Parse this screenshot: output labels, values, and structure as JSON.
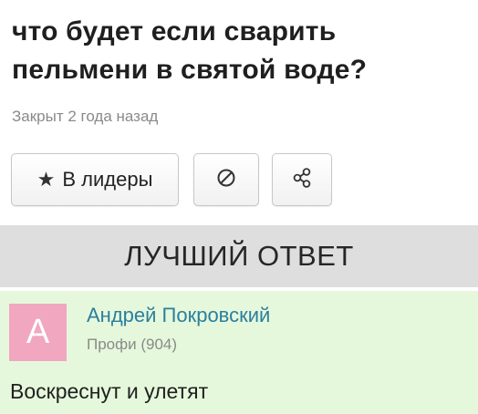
{
  "question": {
    "title": "что будет если сварить пельмени в святой воде?",
    "status": "Закрыт 2 года назад"
  },
  "actions": {
    "leaders_label": "В лидеры",
    "leaders_icon": "star-icon",
    "block_icon": "prohibit-icon",
    "share_icon": "share-icon"
  },
  "best_answer": {
    "header": "ЛУЧШИЙ ОТВЕТ",
    "avatar_letter": "А",
    "avatar_color": "#f0a7bf",
    "author_name": "Андрей Покровский",
    "author_rank": "Профи (904)",
    "text": "Воскреснут и улетят"
  },
  "colors": {
    "answer_bg": "#e6f8dc",
    "header_bg": "#dedede",
    "author_link": "#2a7f9e"
  }
}
